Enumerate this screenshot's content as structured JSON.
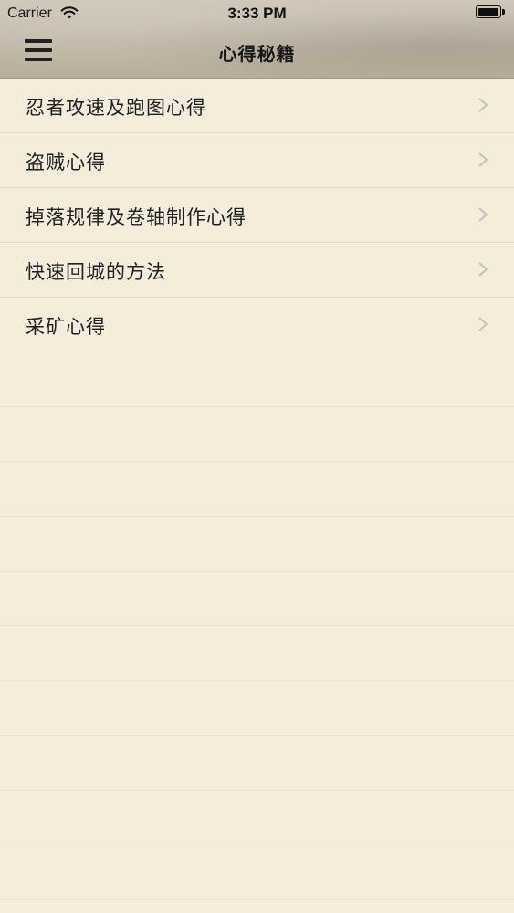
{
  "status_bar": {
    "carrier": "Carrier",
    "time": "3:33 PM",
    "wifi_icon": "wifi-icon",
    "battery_icon": "battery-icon"
  },
  "nav": {
    "title": "心得秘籍",
    "menu_icon": "hamburger-menu-icon"
  },
  "list": {
    "items": [
      {
        "label": "忍者攻速及跑图心得"
      },
      {
        "label": "盗贼心得"
      },
      {
        "label": "掉落规律及卷轴制作心得"
      },
      {
        "label": "快速回城的方法"
      },
      {
        "label": "采矿心得"
      }
    ],
    "chevron_icon": "chevron-right-icon"
  },
  "colors": {
    "background": "#f5ecdc",
    "header_top": "#cfc6b7",
    "header_bottom": "#b8ad9c",
    "separator": "#e3dac9",
    "text": "#202020",
    "chevron": "#c7c1b8"
  }
}
